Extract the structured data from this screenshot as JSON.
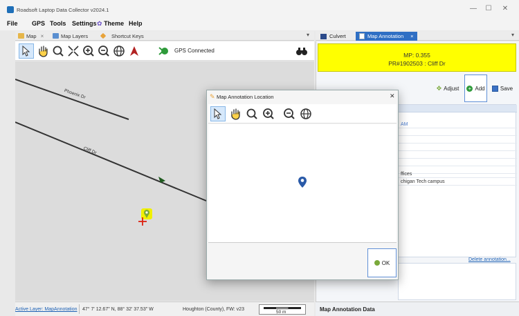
{
  "window": {
    "title": "Roadsoft Laptop Data Collector v2024.1",
    "minimize": "—",
    "maximize": "☐",
    "close": "✕"
  },
  "menu": {
    "items": [
      "File",
      "GPS",
      "Tools",
      "Settings",
      "Theme",
      "Help"
    ]
  },
  "left_tabs": {
    "items": [
      "Map",
      "Map Layers",
      "Shortcut Keys"
    ],
    "close": "×",
    "dropdown": "▾"
  },
  "left_toolbar": {
    "gps_status": "GPS Connected"
  },
  "map": {
    "roads": [
      "Phoenix Dr",
      "Cliff Dr"
    ]
  },
  "status_bar": {
    "active_layer": "Active Layer: MapAnnotation",
    "coordinates": "47° 7' 12.67\" N, 88° 32' 37.53\" W",
    "county": "Houghton (County), FW: v23",
    "scale": "50 m"
  },
  "right_tabs": {
    "items": [
      "Culvert",
      "Map Annotation"
    ],
    "close": "×",
    "dropdown": "▾"
  },
  "annotation_header": {
    "mp": "MP: 0.355",
    "pr": "PR#1902503 : Cliff Dr"
  },
  "right_toolbar": {
    "adjust": "Adjust",
    "add": "Add",
    "save": "Save"
  },
  "properties": {
    "rows": [
      "",
      "AM",
      "",
      "",
      "",
      "",
      "",
      "",
      "ffices",
      "chigan Tech campus"
    ]
  },
  "delete_link": "Delete annotation...",
  "bottom_panel": {
    "title": "Map Annotation Data"
  },
  "dialog": {
    "title": "Map Annotation Location",
    "close": "✕",
    "ok": "OK"
  },
  "colors": {
    "header_yellow": "#ffff00",
    "tab_active": "#2f6fc4",
    "link": "#1a5fb4"
  }
}
